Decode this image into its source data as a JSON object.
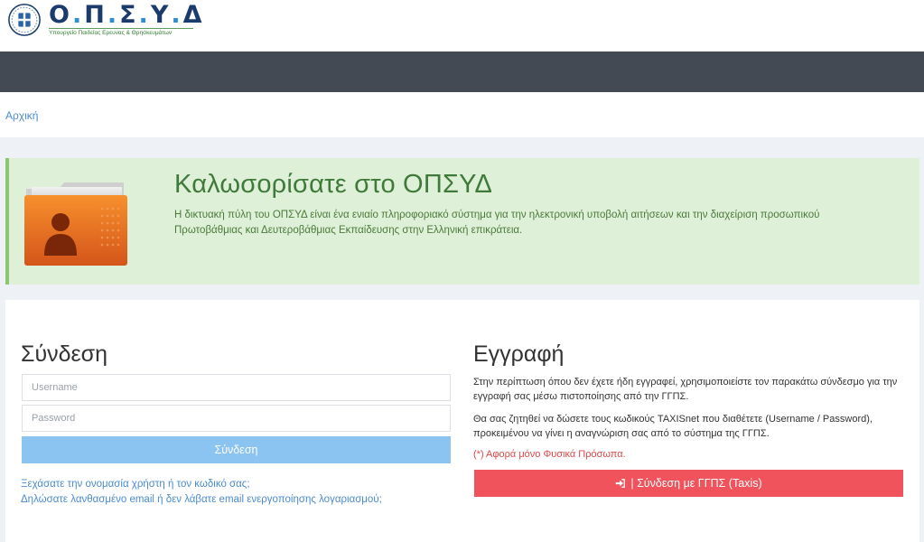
{
  "header": {
    "logo_title": "Ο.Π.Σ.Υ.Δ",
    "logo_letters": [
      "Ο",
      "Π",
      "Σ",
      "Υ",
      "Δ"
    ],
    "logo_subtitle": "Υπουργείο Παιδείας Ερευνας & Θρησκευμάτων",
    "emblem_icon": "greek-emblem-icon"
  },
  "breadcrumb": {
    "home": "Αρχική"
  },
  "welcome": {
    "title": "Καλωσορίσατε στο ΟΠΣΥΔ",
    "text": "Η δικτυακή πύλη του ΟΠΣΥΔ είναι ένα ενιαίο πληροφοριακό σύστημα για την ηλεκτρονική υποβολή αιτήσεων και την διαχείριση προσωπικού Πρωτοβάθμιας και Δευτεροβάθμιας Εκπαίδευσης στην Ελληνική επικράτεια.",
    "icon": "user-folder-icon"
  },
  "login": {
    "heading": "Σύνδεση",
    "username_placeholder": "Username",
    "username_value": "",
    "password_placeholder": "Password",
    "password_value": "",
    "button_label": "Σύνδεση",
    "forgot_link": "Ξεχάσατε την ονομασία χρήστη ή τον κωδικό σας;",
    "wrong_email_link": "Δηλώσατε λανθασμένο email ή δεν λάβατε email ενεργοποίησης λογαριασμού;"
  },
  "register": {
    "heading": "Εγγραφή",
    "text1": "Στην περίπτωση όπου δεν έχετε ήδη εγγραφεί, χρησιμοποιείστε τον παρακάτω σύνδεσμο για την εγγραφή σας μέσω πιστοποίησης από την ΓΓΠΣ.",
    "text2": "Θα σας ζητηθεί να δώσετε τους κωδικούς TAXISnet που διαθέτετε (Username / Password), προκειμένου να γίνει η αναγνώριση σας από το σύστημα της ΓΓΠΣ.",
    "note": "(*) Αφορά μόνο Φυσικά Πρόσωπα.",
    "taxis_button_label": "| Σύνδεση με ΓΓΠΣ (Taxis)",
    "taxis_icon": "sign-in-icon"
  },
  "colors": {
    "navbar": "#434a54",
    "welcome_bg": "#dff0d8",
    "welcome_text": "#3f7a3a",
    "link": "#4a8ccf",
    "login_button": "#8bc3f1",
    "taxis_button": "#f0535c",
    "note": "#e04848"
  }
}
